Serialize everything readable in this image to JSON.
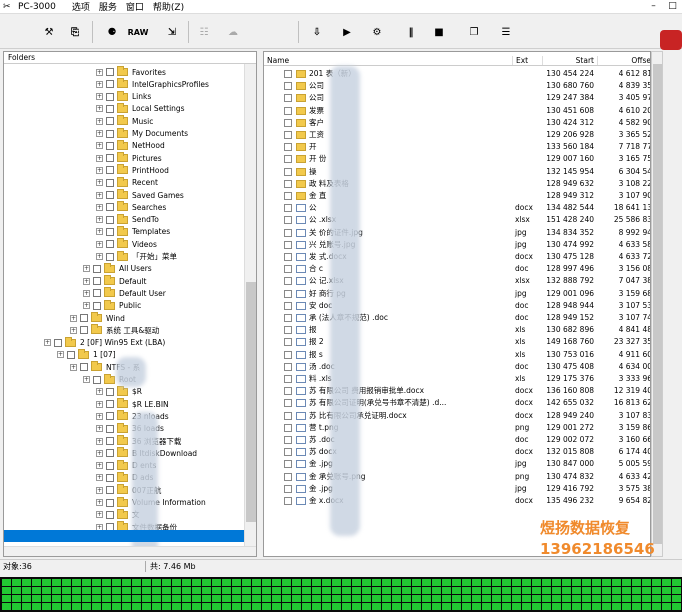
{
  "app": {
    "title": "PC-3000",
    "menus": [
      "选项",
      "服务",
      "窗口",
      "帮助(Z)"
    ]
  },
  "toolbar": {
    "raw_label": "RAW"
  },
  "left_pane": {
    "header": "Folders",
    "items": [
      {
        "label": "Favorites",
        "indent": 6
      },
      {
        "label": "IntelGraphicsProfiles",
        "indent": 6
      },
      {
        "label": "Links",
        "indent": 6
      },
      {
        "label": "Local Settings",
        "indent": 6
      },
      {
        "label": "Music",
        "indent": 6
      },
      {
        "label": "My Documents",
        "indent": 6
      },
      {
        "label": "NetHood",
        "indent": 6
      },
      {
        "label": "Pictures",
        "indent": 6
      },
      {
        "label": "PrintHood",
        "indent": 6
      },
      {
        "label": "Recent",
        "indent": 6
      },
      {
        "label": "Saved Games",
        "indent": 6
      },
      {
        "label": "Searches",
        "indent": 6
      },
      {
        "label": "SendTo",
        "indent": 6
      },
      {
        "label": "Templates",
        "indent": 6
      },
      {
        "label": "Videos",
        "indent": 6
      },
      {
        "label": "「开始」菜单",
        "indent": 6
      },
      {
        "label": "All Users",
        "indent": 5
      },
      {
        "label": "Default",
        "indent": 5
      },
      {
        "label": "Default User",
        "indent": 5
      },
      {
        "label": "Public",
        "indent": 5
      },
      {
        "label": "Wind",
        "indent": 4
      },
      {
        "label": "系统 工具&驱动",
        "indent": 4
      },
      {
        "label": "2 [0F] Win95 Ext (LBA)",
        "indent": 2
      },
      {
        "label": "1 [07]",
        "indent": 3
      },
      {
        "label": "NTFS - 系",
        "indent": 4
      },
      {
        "label": "Root",
        "indent": 5
      },
      {
        "label": "$R",
        "indent": 6
      },
      {
        "label": "$R LE.BIN",
        "indent": 6
      },
      {
        "label": "23 nloads",
        "indent": 6
      },
      {
        "label": "36 loads",
        "indent": 6
      },
      {
        "label": "36 浏览器下载",
        "indent": 6
      },
      {
        "label": "B ItdiskDownload",
        "indent": 6
      },
      {
        "label": "D ents",
        "indent": 6
      },
      {
        "label": "D ads",
        "indent": 6
      },
      {
        "label": "007正航",
        "indent": 6
      },
      {
        "label": "Volume Information",
        "indent": 6
      },
      {
        "label": "文",
        "indent": 6
      },
      {
        "label": "文件数据备份",
        "indent": 6
      }
    ]
  },
  "right_pane": {
    "columns": {
      "name": "Name",
      "ext": "Ext",
      "start": "Start",
      "offset": "Offse"
    },
    "rows": [
      {
        "icon": "folder",
        "name": "201 表（新）",
        "ext": "",
        "start": "130 454 224",
        "off": "4 612 81"
      },
      {
        "icon": "folder",
        "name": "公司",
        "ext": "",
        "start": "130 680 760",
        "off": "4 839 35"
      },
      {
        "icon": "folder",
        "name": "公司",
        "ext": "",
        "start": "129 247 384",
        "off": "3 405 97"
      },
      {
        "icon": "folder",
        "name": "发票",
        "ext": "",
        "start": "130 451 608",
        "off": "4 610 20"
      },
      {
        "icon": "folder",
        "name": "客户",
        "ext": "",
        "start": "130 424 312",
        "off": "4 582 90"
      },
      {
        "icon": "folder",
        "name": "工资",
        "ext": "",
        "start": "129 206 928",
        "off": "3 365 52"
      },
      {
        "icon": "folder",
        "name": "开",
        "ext": "",
        "start": "133 560 184",
        "off": "7 718 77"
      },
      {
        "icon": "folder",
        "name": "开 份",
        "ext": "",
        "start": "129 007 160",
        "off": "3 165 75"
      },
      {
        "icon": "folder",
        "name": "操",
        "ext": "",
        "start": "132 145 954",
        "off": "6 304 54"
      },
      {
        "icon": "folder",
        "name": "政 料及表格",
        "ext": "",
        "start": "128 949 632",
        "off": "3 108 22"
      },
      {
        "icon": "folder",
        "name": "金 直",
        "ext": "",
        "start": "128 949 312",
        "off": "3 107 90"
      },
      {
        "icon": "file",
        "name": "公",
        "ext": "docx",
        "start": "134 482 544",
        "off": "18 641 13"
      },
      {
        "icon": "file",
        "name": "公 .xlsx",
        "ext": "xlsx",
        "start": "151 428 240",
        "off": "25 586 83"
      },
      {
        "icon": "file",
        "name": "关 价的证件.jpg",
        "ext": "jpg",
        "start": "134 834 352",
        "off": "8 992 94"
      },
      {
        "icon": "file",
        "name": "兴 兑账号.jpg",
        "ext": "jpg",
        "start": "130 474 992",
        "off": "4 633 58"
      },
      {
        "icon": "file",
        "name": "发 式.docx",
        "ext": "docx",
        "start": "130 475 128",
        "off": "4 633 72"
      },
      {
        "icon": "file",
        "name": "合 c",
        "ext": "doc",
        "start": "128 997 496",
        "off": "3 156 08"
      },
      {
        "icon": "file",
        "name": "公 记.xlsx",
        "ext": "xlsx",
        "start": "132 888 792",
        "off": "7 047 38"
      },
      {
        "icon": "file",
        "name": "好 商行 pg",
        "ext": "jpg",
        "start": "129 001 096",
        "off": "3 159 68"
      },
      {
        "icon": "file",
        "name": "安 doc",
        "ext": "doc",
        "start": "128 948 944",
        "off": "3 107 53"
      },
      {
        "icon": "file",
        "name": "承 (法人章不规范) .doc",
        "ext": "doc",
        "start": "128 949 152",
        "off": "3 107 74"
      },
      {
        "icon": "file",
        "name": "报",
        "ext": "xls",
        "start": "130 682 896",
        "off": "4 841 48"
      },
      {
        "icon": "file",
        "name": "报 2",
        "ext": "xls",
        "start": "149 168 760",
        "off": "23 327 35"
      },
      {
        "icon": "file",
        "name": "报 s",
        "ext": "xls",
        "start": "130 753 016",
        "off": "4 911 60"
      },
      {
        "icon": "file",
        "name": "汤 .doc",
        "ext": "doc",
        "start": "130 475 408",
        "off": "4 634 00"
      },
      {
        "icon": "file",
        "name": "料 .xls",
        "ext": "xls",
        "start": "129 175 376",
        "off": "3 333 96"
      },
      {
        "icon": "file",
        "name": "苏 有限公司 费用报销审批单.docx",
        "ext": "docx",
        "start": "136 160 808",
        "off": "12 319 40"
      },
      {
        "icon": "file",
        "name": "苏 有限公司证明(承兑号书章不清楚) .d...",
        "ext": "docx",
        "start": "142 655 032",
        "off": "16 813 62"
      },
      {
        "icon": "file",
        "name": "苏 比有限公司承兑证明.docx",
        "ext": "docx",
        "start": "128 949 240",
        "off": "3 107 83"
      },
      {
        "icon": "file",
        "name": "营 t.png",
        "ext": "png",
        "start": "129 001 272",
        "off": "3 159 86"
      },
      {
        "icon": "file",
        "name": "苏 .doc",
        "ext": "doc",
        "start": "129 002 072",
        "off": "3 160 66"
      },
      {
        "icon": "file",
        "name": "苏 docx",
        "ext": "docx",
        "start": "132 015 808",
        "off": "6 174 40"
      },
      {
        "icon": "file",
        "name": "金 .jpg",
        "ext": "jpg",
        "start": "130 847 000",
        "off": "5 005 59"
      },
      {
        "icon": "file",
        "name": "金 承兑账号.png",
        "ext": "png",
        "start": "130 474 832",
        "off": "4 633 42"
      },
      {
        "icon": "file",
        "name": "金 .jpg",
        "ext": "jpg",
        "start": "129 416 792",
        "off": "3 575 38"
      },
      {
        "icon": "file",
        "name": "金 x.docx",
        "ext": "docx",
        "start": "135 496 232",
        "off": "9 654 82"
      }
    ]
  },
  "status": {
    "objects": "对象:36",
    "total": "共: 7.46 Mb"
  },
  "watermark": {
    "line1": "煜扬数据恢复",
    "line2": "13962186546"
  },
  "colors": {
    "selection": "#0078d7",
    "map_block": "#22c933",
    "watermark": "#f08a2c"
  }
}
